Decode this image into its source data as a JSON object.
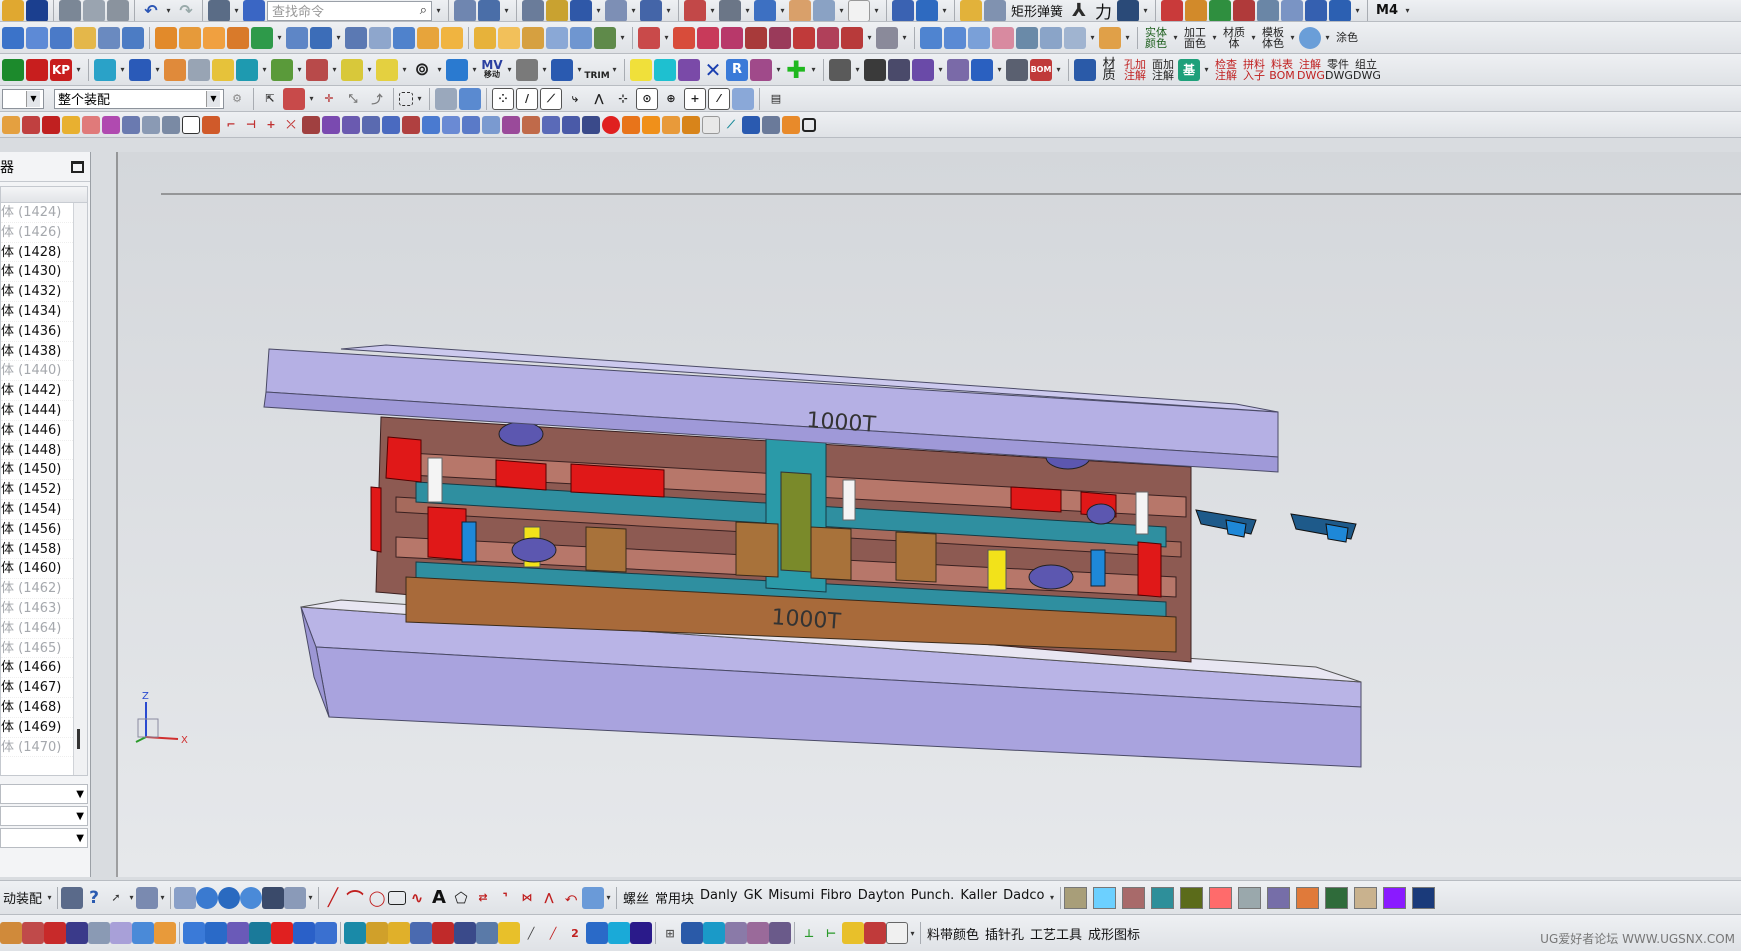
{
  "toolbar1": {
    "search_placeholder": "查找命令",
    "spring_label": "矩形弹簧",
    "force_label": "力",
    "m4_label": "M4"
  },
  "toolbar2": {
    "buttons": [
      {
        "label": "实体\n颜色"
      },
      {
        "label": "加工\n面色"
      },
      {
        "label": "材质\n体"
      },
      {
        "label": "模板\n体色"
      },
      {
        "label": "涂色"
      }
    ]
  },
  "toolbar3": {
    "mv_label": "MV",
    "mv_sub": "移动",
    "trim_label": "TRIM",
    "bom_label": "BOM",
    "buttons": [
      {
        "label": "材质"
      },
      {
        "label": "孔加\n注解"
      },
      {
        "label": "面加\n注解"
      },
      {
        "label": "基"
      },
      {
        "label": "检查\n注解"
      },
      {
        "label": "拼料\n入子"
      },
      {
        "label": "料表\nBOM"
      },
      {
        "label": "注解\nDWG"
      },
      {
        "label": "零件\nDWG"
      },
      {
        "label": "组立\nDWG"
      }
    ]
  },
  "toolbar4": {
    "selection_filter": "",
    "assembly_scope": "整个装配"
  },
  "panel": {
    "title": "器",
    "tree_items": [
      {
        "label": "体 (1424)",
        "dim": true
      },
      {
        "label": "体 (1426)",
        "dim": true
      },
      {
        "label": "体 (1428)",
        "dim": false
      },
      {
        "label": "体 (1430)",
        "dim": false
      },
      {
        "label": "体 (1432)",
        "dim": false
      },
      {
        "label": "体 (1434)",
        "dim": false
      },
      {
        "label": "体 (1436)",
        "dim": false
      },
      {
        "label": "体 (1438)",
        "dim": false
      },
      {
        "label": "体 (1440)",
        "dim": true
      },
      {
        "label": "体 (1442)",
        "dim": false
      },
      {
        "label": "体 (1444)",
        "dim": false
      },
      {
        "label": "体 (1446)",
        "dim": false
      },
      {
        "label": "体 (1448)",
        "dim": false
      },
      {
        "label": "体 (1450)",
        "dim": false
      },
      {
        "label": "体 (1452)",
        "dim": false
      },
      {
        "label": "体 (1454)",
        "dim": false
      },
      {
        "label": "体 (1456)",
        "dim": false
      },
      {
        "label": "体 (1458)",
        "dim": false
      },
      {
        "label": "体 (1460)",
        "dim": false
      },
      {
        "label": "体 (1462)",
        "dim": true
      },
      {
        "label": "体 (1463)",
        "dim": true
      },
      {
        "label": "体 (1464)",
        "dim": true
      },
      {
        "label": "体 (1465)",
        "dim": true
      },
      {
        "label": "体 (1466)",
        "dim": false
      },
      {
        "label": "体 (1467)",
        "dim": false
      },
      {
        "label": "体 (1468)",
        "dim": false
      },
      {
        "label": "体 (1469)",
        "dim": false
      },
      {
        "label": "体 (1470)",
        "dim": true
      }
    ]
  },
  "viewport": {
    "upper_plate_label": "1000T",
    "lower_plate_label": "1000T",
    "triad": {
      "z": "Z",
      "x": "X"
    }
  },
  "bottom_bar1": {
    "left_label": "动装配",
    "vendor_items": [
      "螺丝",
      "常用块",
      "Danly",
      "GK",
      "Misumi",
      "Fibro",
      "Dayton",
      "Punch.",
      "Kaller",
      "Dadco"
    ],
    "swatches": [
      "#a89e79",
      "#6cd0ff",
      "#a86a6a",
      "#2e8f9a",
      "#5b6b1a",
      "#ff6b6b",
      "#9aa8ac",
      "#766ea8",
      "#e07a3a",
      "#2f6b3a",
      "#c9b28e",
      "#8a1aff",
      "#1a3a7a"
    ]
  },
  "bottom_bar2": {
    "text_buttons": [
      "料带颜色",
      "插针孔",
      "工艺工具",
      "成形图标"
    ]
  },
  "watermark": "UG爱好者论坛 WWW.UGSNX.COM"
}
